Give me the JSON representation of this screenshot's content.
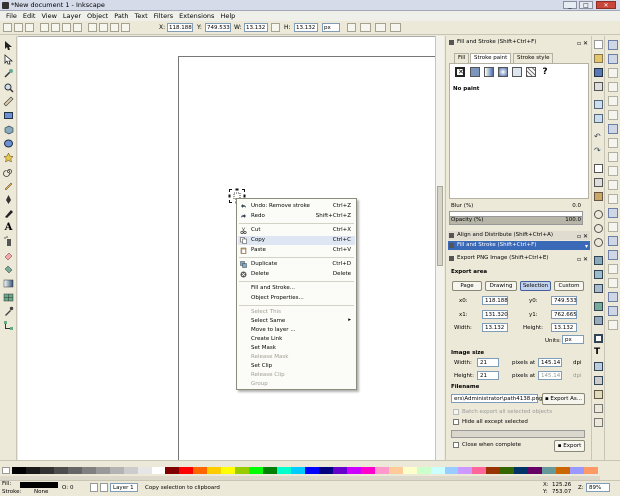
{
  "window": {
    "title": "*New document 1 - Inkscape"
  },
  "menubar": {
    "items": [
      "File",
      "Edit",
      "View",
      "Layer",
      "Object",
      "Path",
      "Text",
      "Filters",
      "Extensions",
      "Help"
    ]
  },
  "controls": {
    "x_label": "X:",
    "x_value": "118.188",
    "y_label": "Y:",
    "y_value": "749.533",
    "w_label": "W:",
    "w_value": "13.132",
    "h_label": "H:",
    "h_value": "13.132",
    "unit": "px"
  },
  "context_menu": {
    "items": [
      {
        "label": "Undo: Remove stroke",
        "shortcut": "Ctrl+Z",
        "icon": "undo-icon"
      },
      {
        "label": "Redo",
        "shortcut": "Shift+Ctrl+Z",
        "icon": "redo-icon"
      },
      {
        "label": "Cut",
        "shortcut": "Ctrl+X",
        "icon": "cut-icon"
      },
      {
        "label": "Copy",
        "shortcut": "Ctrl+C",
        "icon": "copy-icon"
      },
      {
        "label": "Paste",
        "shortcut": "Ctrl+V",
        "icon": "paste-icon"
      },
      {
        "label": "Duplicate",
        "shortcut": "Ctrl+D",
        "icon": "duplicate-icon"
      },
      {
        "label": "Delete",
        "shortcut": "Delete",
        "icon": "delete-icon"
      },
      {
        "label": "Fill and Stroke...",
        "shortcut": "",
        "icon": ""
      },
      {
        "label": "Object Properties...",
        "shortcut": "",
        "icon": ""
      },
      {
        "label": "Select This",
        "shortcut": "",
        "icon": "",
        "disabled": true
      },
      {
        "label": "Select Same",
        "shortcut": "",
        "icon": "",
        "submenu": true
      },
      {
        "label": "Move to layer ...",
        "shortcut": "",
        "icon": ""
      },
      {
        "label": "Create Link",
        "shortcut": "",
        "icon": ""
      },
      {
        "label": "Set Mask",
        "shortcut": "",
        "icon": ""
      },
      {
        "label": "Release Mask",
        "shortcut": "",
        "icon": "",
        "disabled": true
      },
      {
        "label": "Set Clip",
        "shortcut": "",
        "icon": ""
      },
      {
        "label": "Release Clip",
        "shortcut": "",
        "icon": "",
        "disabled": true
      },
      {
        "label": "Group",
        "shortcut": "",
        "icon": "",
        "disabled": true
      }
    ]
  },
  "fill_stroke": {
    "title": "Fill and Stroke (Shift+Ctrl+F)",
    "tabs": [
      "Fill",
      "Stroke paint",
      "Stroke style"
    ],
    "paint_status": "No paint",
    "blur_label": "Blur (%)",
    "blur_value": "0.0",
    "opacity_label": "Opacity (%)",
    "opacity_value": "100.0"
  },
  "collapsed_panels": {
    "align": "Align and Distribute (Shift+Ctrl+A)",
    "fill_stroke_collapsed": "Fill and Stroke (Shift+Ctrl+F)"
  },
  "export_png": {
    "title": "Export PNG Image (Shift+Ctrl+E)",
    "area_heading": "Export area",
    "area_buttons": [
      "Page",
      "Drawing",
      "Selection",
      "Custom"
    ],
    "selected_area": "Selection",
    "x0_label": "x0:",
    "x0_value": "118.188",
    "y0_label": "y0:",
    "y0_value": "749.533",
    "x1_label": "x1:",
    "x1_value": "131.320",
    "y1_label": "y1:",
    "y1_value": "762.665",
    "width_label": "Width:",
    "width_value": "13.132",
    "height_label": "Height:",
    "height_value": "13.132",
    "units_label": "Units:",
    "units_value": "px",
    "size_heading": "Image size",
    "img_width_label": "Width:",
    "img_width_value": "21",
    "pixels_at_label": "pixels at",
    "dpi_value_1": "145.14",
    "dpi_label": "dpi",
    "img_height_label": "Height:",
    "img_height_value": "21",
    "dpi_value_2": "145.14",
    "filename_heading": "Filename",
    "filename_value": "ers\\Administrator\\path4138.png",
    "export_as_label": "Export As...",
    "batch_label": "Batch export all selected objects",
    "hide_label": "Hide all except selected",
    "close_label": "Close when complete",
    "export_label": "Export"
  },
  "status": {
    "fill_label": "Fill:",
    "stroke_label": "Stroke:",
    "stroke_value": "None",
    "opacity_label": "O:",
    "opacity_value": "0",
    "layer": "Layer 1",
    "message": "Copy selection to clipboard",
    "x_label": "X:",
    "x_coord": "125.26",
    "y_label": "Y:",
    "y_coord": "753.07",
    "zoom_label": "Z:",
    "zoom": "89%"
  },
  "palette_colors": [
    "#000000",
    "#1a1a1a",
    "#333333",
    "#4d4d4d",
    "#666666",
    "#808080",
    "#999999",
    "#b3b3b3",
    "#cccccc",
    "#e6e6e6",
    "#ffffff",
    "#800000",
    "#ff0000",
    "#ff6600",
    "#ffcc00",
    "#ffff00",
    "#99cc00",
    "#00ff00",
    "#008000",
    "#00ffcc",
    "#00ccff",
    "#0000ff",
    "#000080",
    "#6600cc",
    "#cc00ff",
    "#ff00cc",
    "#ff99cc",
    "#ffcc99",
    "#ffffcc",
    "#ccffcc",
    "#ccffff",
    "#99ccff",
    "#cc99ff",
    "#ff6699",
    "#993300",
    "#336600",
    "#003366",
    "#660066",
    "#669999",
    "#cc6600",
    "#9999ff",
    "#ff9966"
  ]
}
